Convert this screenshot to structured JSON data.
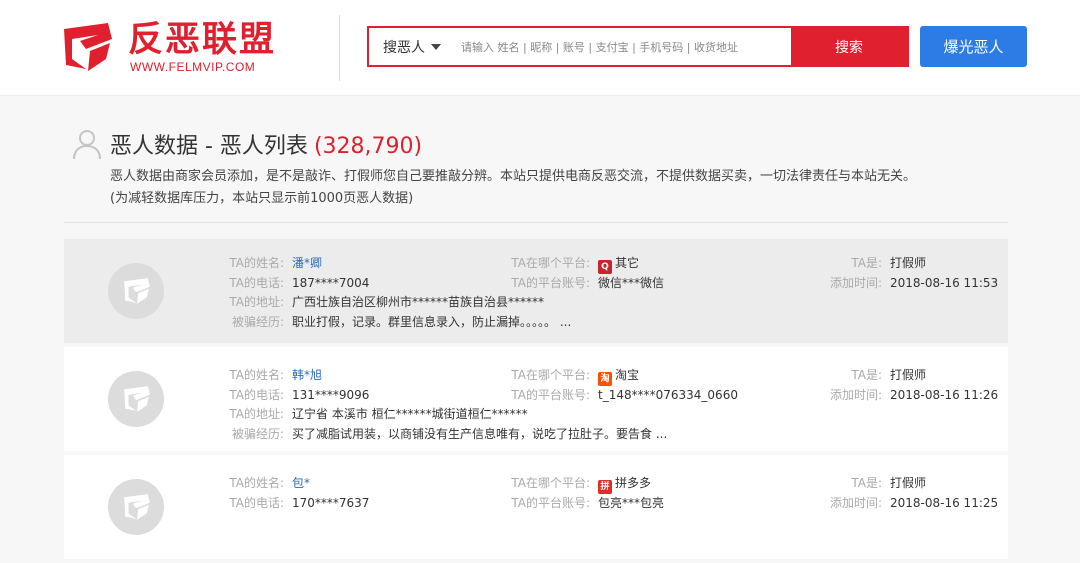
{
  "header": {
    "logo_title": "反恶联盟",
    "logo_url": "WWW.FELMVIP.COM",
    "search_type": "搜恶人",
    "search_placeholder": "请输入 姓名 | 昵称 | 账号 | 支付宝 | 手机号码 | 收货地址",
    "search_button": "搜索",
    "expose_button": "爆光恶人"
  },
  "colors": {
    "brand_red": "#e0202e",
    "accent_blue": "#2d7be5"
  },
  "page": {
    "title": "恶人数据 - 恶人列表",
    "count": "(328,790)",
    "notice_line1": "恶人数据由商家会员添加，是不是敲诈、打假师您自己要推敲分辨。本站只提供电商反恶交流，不提供数据买卖，一切法律责任与本站无关。",
    "notice_line2": "(为减轻数据库压力，本站只显示前1000页恶人数据)"
  },
  "labels": {
    "name": "TA的姓名:",
    "phone": "TA的电话:",
    "address": "TA的地址:",
    "experience": "被骗经历:",
    "platform": "TA在哪个平台:",
    "account": "TA的平台账号:",
    "type": "TA是:",
    "added": "添加时间:"
  },
  "records": [
    {
      "name": "潘*卿",
      "phone": "187****7004",
      "address": "广西壮族自治区柳州市******苗族自治县******",
      "experience": "职业打假，记录。群里信息录入，防止漏掉。。。。。 ...",
      "platform": "其它",
      "platform_icon": "other-platform-icon",
      "account": "微信***微信",
      "type": "打假师",
      "added": "2018-08-16 11:53"
    },
    {
      "name": "韩*旭",
      "phone": "131****9096",
      "address": "辽宁省 本溪市 桓仁******城街道桓仁******",
      "experience": "买了减脂试用装，以商铺没有生产信息唯有，说吃了拉肚子。要告食 ...",
      "platform": "淘宝",
      "platform_icon": "taobao-icon",
      "account": "t_148****076334_0660",
      "type": "打假师",
      "added": "2018-08-16 11:26"
    },
    {
      "name": "包*",
      "phone": "170****7637",
      "address": "",
      "experience": "",
      "platform": "拼多多",
      "platform_icon": "pinduoduo-icon",
      "account": "包亮***包亮",
      "type": "打假师",
      "added": "2018-08-16 11:25"
    }
  ]
}
